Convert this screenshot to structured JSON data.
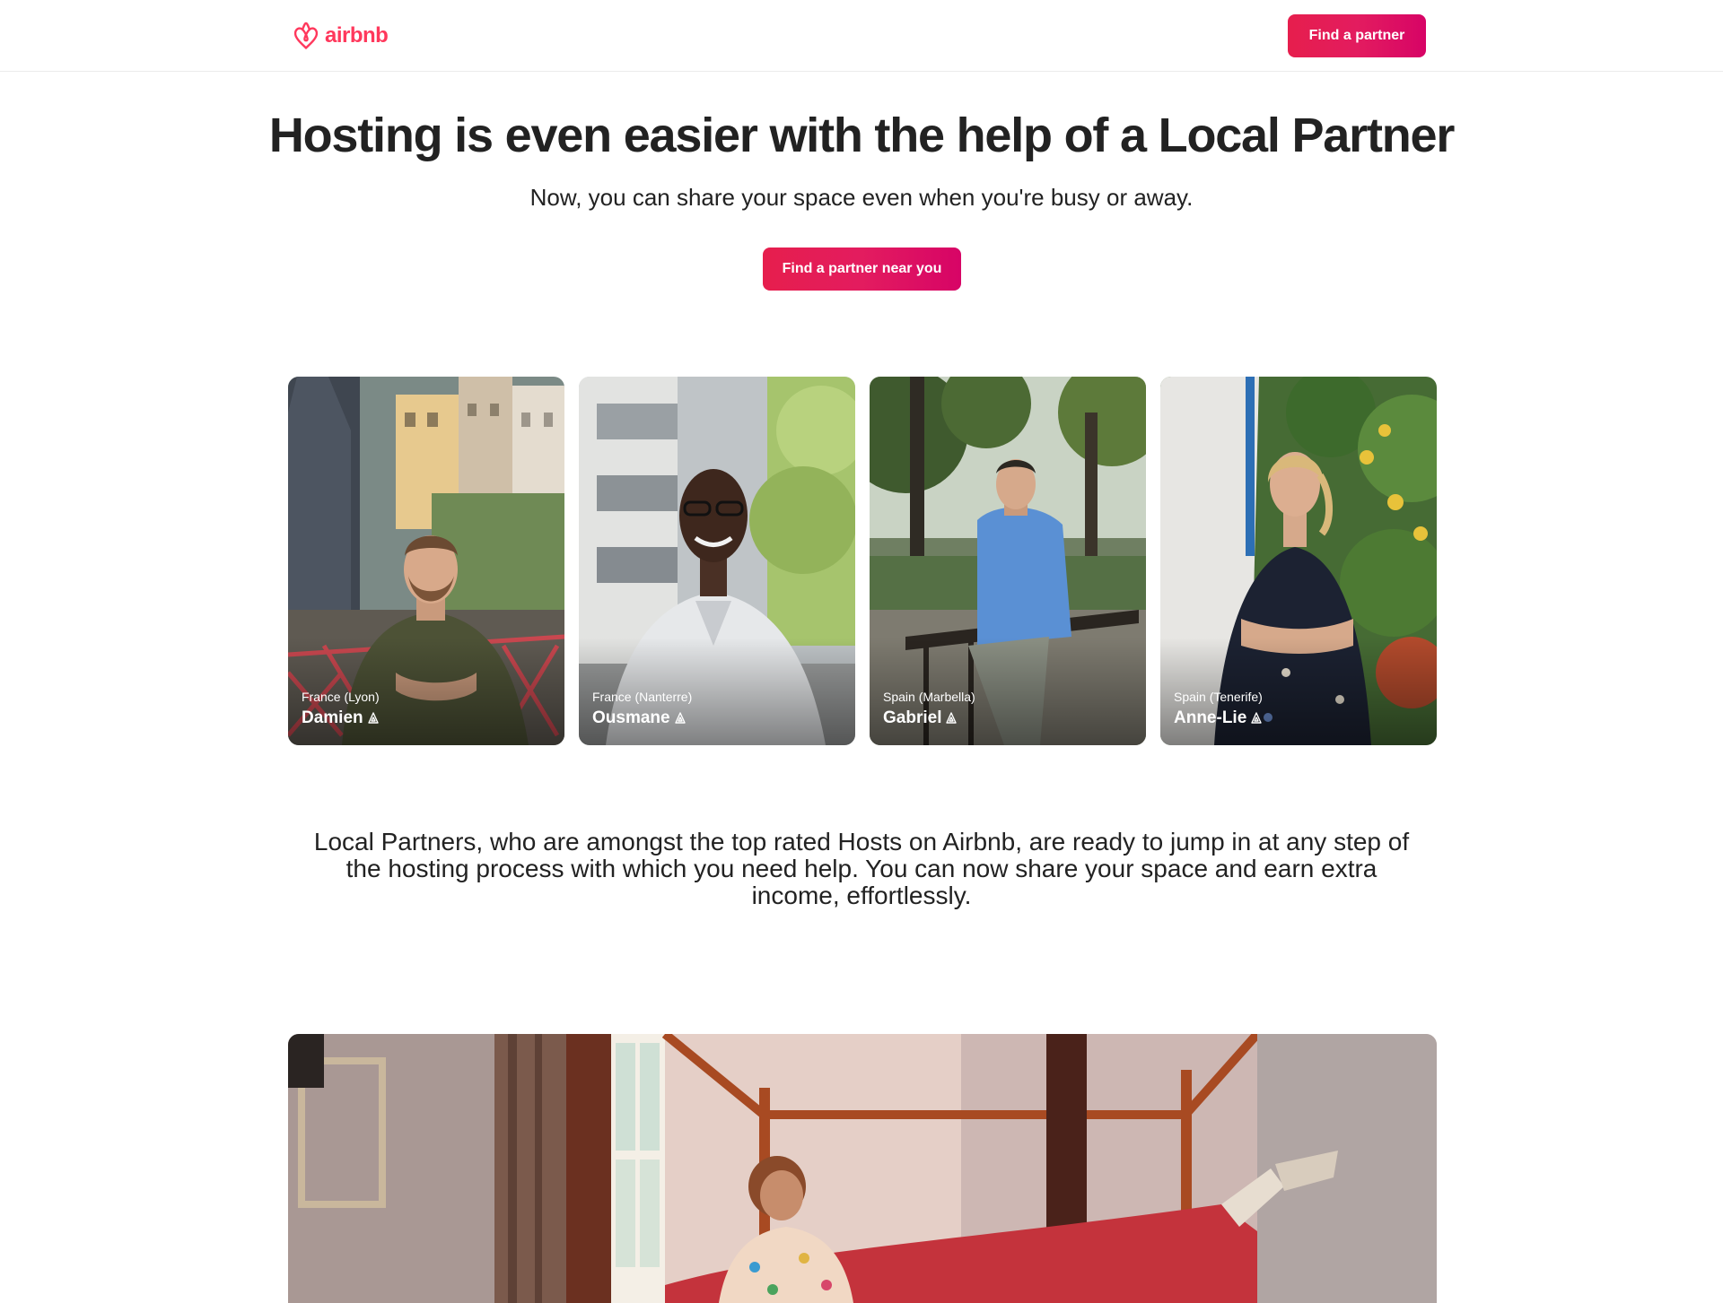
{
  "header": {
    "logo_text": "airbnb",
    "cta_label": "Find a partner"
  },
  "hero": {
    "title": "Hosting is even easier with the help of a Local Partner",
    "subtitle": "Now, you can share your space even when you're busy or away.",
    "cta_label": "Find a partner near you"
  },
  "partners": [
    {
      "location": "France (Lyon)",
      "name": "Damien"
    },
    {
      "location": "France (Nanterre)",
      "name": "Ousmane"
    },
    {
      "location": "Spain (Marbella)",
      "name": "Gabriel"
    },
    {
      "location": "Spain (Tenerife)",
      "name": "Anne-Lie"
    }
  ],
  "description": "Local Partners, who are amongst the top rated Hosts on Airbnb, are ready to jump in at any step of the hosting process with which you need help. You can now share your space and earn extra income, effortlessly.",
  "colors": {
    "brand": "#FF385C",
    "cta_gradient_start": "#E61E4D",
    "cta_gradient_end": "#D70466",
    "text": "#222222"
  },
  "icons": [
    "airbnb-logo-icon",
    "superhost-badge-icon"
  ]
}
